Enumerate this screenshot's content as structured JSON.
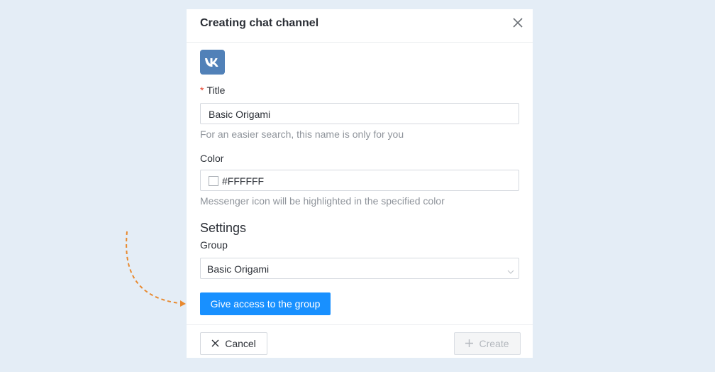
{
  "modal": {
    "title": "Creating chat channel",
    "close_icon": "close-icon",
    "channel_logo": "vk-logo-icon",
    "title_field": {
      "required_mark": "*",
      "label": "Title",
      "value": "Basic Origami",
      "hint": "For an easier search, this name is only for you"
    },
    "color_field": {
      "label": "Color",
      "value": "#FFFFFF",
      "hint": "Messenger icon will be highlighted in the specified color"
    },
    "settings": {
      "heading": "Settings",
      "group_label": "Group",
      "group_value": "Basic Origami"
    },
    "give_access_label": "Give access to the group",
    "footer": {
      "cancel_label": "Cancel",
      "create_label": "Create"
    }
  },
  "colors": {
    "primary": "#1890ff",
    "vk_brand": "#5181b8",
    "annotation_arrow": "#e8892e",
    "required": "#e5402b"
  }
}
